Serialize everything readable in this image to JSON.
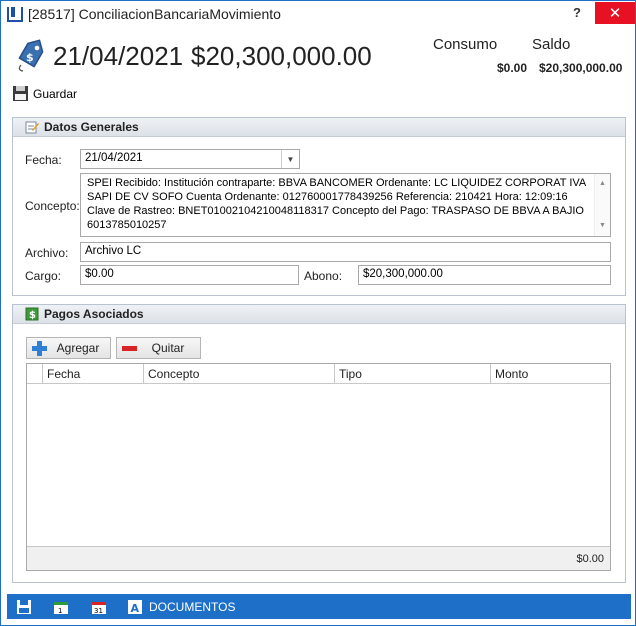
{
  "window": {
    "title": "[28517] ConciliacionBancariaMovimiento",
    "help": "?",
    "close": "✕"
  },
  "header": {
    "date": "21/04/2021",
    "amount": "$20,300,000.00",
    "consumo_label": "Consumo",
    "saldo_label": "Saldo",
    "consumo_value": "$0.00",
    "saldo_value": "$20,300,000.00"
  },
  "toolbar": {
    "save_label": "Guardar"
  },
  "datos": {
    "title": "Datos Generales",
    "fecha_label": "Fecha:",
    "fecha_value": "21/04/2021",
    "concepto_label": "Concepto:",
    "concepto_value": " SPEI Recibido:  Institución contraparte: BBVA BANCOMER Ordenante: LC LIQUIDEZ CORPORAT IVA SAPI DE CV SOFO Cuenta Ordenante: 012760001778439256 Referencia: 210421  Hora: 12:09:16 Clave de Rastreo: BNET01002104210048118317 Concepto del Pago: TRASPASO DE BBVA A BAJIO 6013785010257",
    "archivo_label": "Archivo:",
    "archivo_value": "Archivo LC",
    "cargo_label": "Cargo:",
    "cargo_value": "$0.00",
    "abono_label": "Abono:",
    "abono_value": "$20,300,000.00"
  },
  "pagos": {
    "title": "Pagos Asociados",
    "add_label": "Agregar",
    "remove_label": "Quitar",
    "columns": [
      "Fecha",
      "Concepto",
      "Tipo",
      "Monto"
    ],
    "total": "$0.00"
  },
  "statusbar": {
    "documents_label": "DOCUMENTOS"
  },
  "colors": {
    "accent": "#1e6fc8",
    "close": "#e81123"
  }
}
